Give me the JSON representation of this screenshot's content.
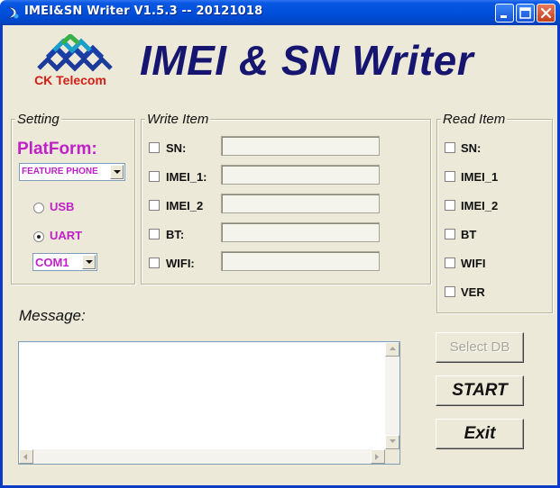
{
  "window": {
    "title": "IMEI&SN Writer V1.5.3 -- 20121018"
  },
  "header": {
    "logo_text": "CK Telecom",
    "app_title": "IMEI & SN Writer"
  },
  "setting": {
    "group_label": "Setting",
    "platform_label": "PlatForm:",
    "platform_selected": "FEATURE PHONE",
    "radios": [
      {
        "label": "USB",
        "selected": false
      },
      {
        "label": "UART",
        "selected": true
      }
    ],
    "com_selected": "COM1"
  },
  "write_item": {
    "group_label": "Write Item",
    "items": [
      {
        "label": "SN:",
        "checked": false,
        "value": ""
      },
      {
        "label": "IMEI_1:",
        "checked": false,
        "value": ""
      },
      {
        "label": "IMEI_2",
        "checked": false,
        "value": ""
      },
      {
        "label": "BT:",
        "checked": false,
        "value": ""
      },
      {
        "label": "WIFI:",
        "checked": false,
        "value": ""
      }
    ]
  },
  "read_item": {
    "group_label": "Read Item",
    "items": [
      {
        "label": "SN:",
        "checked": false
      },
      {
        "label": "IMEI_1",
        "checked": false
      },
      {
        "label": "IMEI_2",
        "checked": false
      },
      {
        "label": "BT",
        "checked": false
      },
      {
        "label": "WIFI",
        "checked": false
      },
      {
        "label": "VER",
        "checked": false
      }
    ]
  },
  "message": {
    "label": "Message:",
    "text": ""
  },
  "buttons": {
    "select_db": "Select DB",
    "start": "START",
    "exit": "Exit"
  },
  "colors": {
    "accent_magenta": "#c020c8",
    "title_navy": "#161670",
    "logo_red": "#d21e14",
    "titlebar_blue": "#0050dc"
  }
}
